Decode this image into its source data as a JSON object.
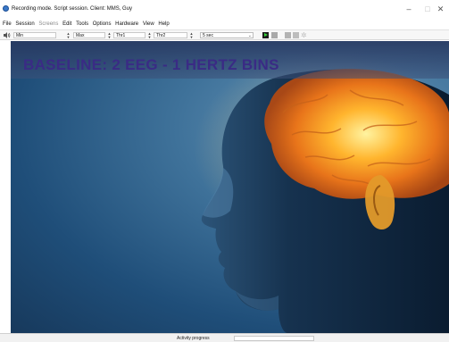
{
  "window": {
    "title": "Recording mode. Script session. Client: MMS, Guy",
    "icon": "app-globe-icon",
    "controls": {
      "minimize": "–",
      "maximize": "□",
      "close": "✕"
    }
  },
  "menu": {
    "items": [
      {
        "label": "File",
        "enabled": true
      },
      {
        "label": "Session",
        "enabled": true
      },
      {
        "label": "Screens",
        "enabled": false
      },
      {
        "label": "Edit",
        "enabled": true
      },
      {
        "label": "Tools",
        "enabled": true
      },
      {
        "label": "Options",
        "enabled": true
      },
      {
        "label": "Hardware",
        "enabled": true
      },
      {
        "label": "View",
        "enabled": true
      },
      {
        "label": "Help",
        "enabled": true
      }
    ]
  },
  "toolbar": {
    "speaker_icon": "speaker-icon",
    "min_label": "Min",
    "max_label": "Max",
    "thr1_label": "Thr1",
    "thr2_label": "Thr2",
    "duration_value": "5 sec",
    "play_color": "#37d13a"
  },
  "display": {
    "headline": "BASELINE: 2 EEG - 1 HERTZ BINS",
    "headline_color": "#3a2b85",
    "background_image": "human head profile with glowing brain"
  },
  "status": {
    "text": "Activity progress"
  }
}
